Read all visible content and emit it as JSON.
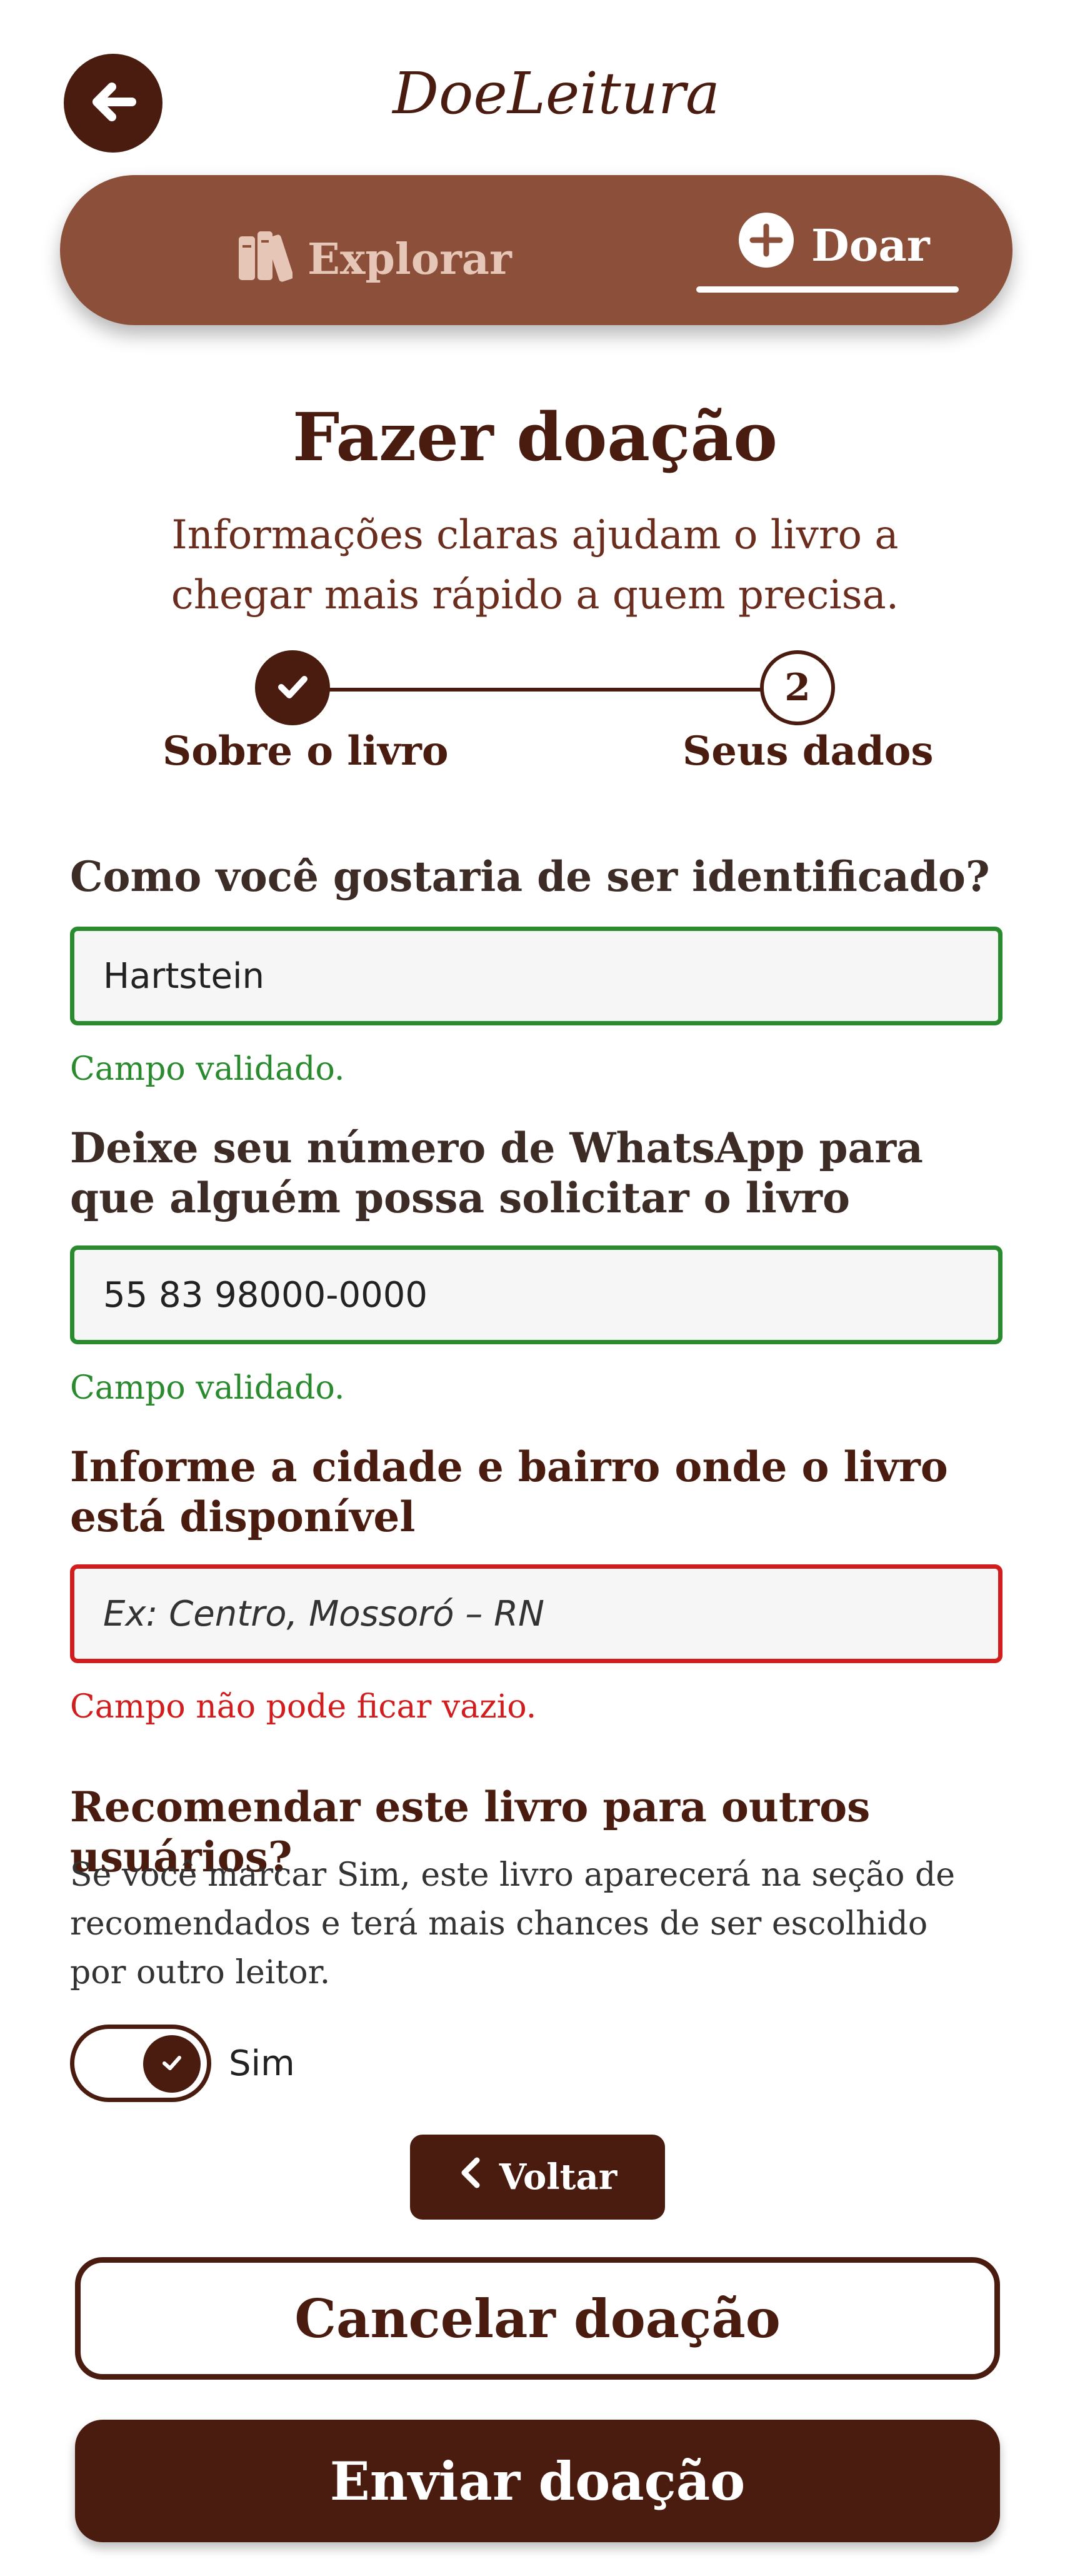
{
  "header": {
    "brand": "DoeLeitura"
  },
  "tabs": [
    {
      "label": "Explorar",
      "icon": "books-icon",
      "active": false
    },
    {
      "label": "Doar",
      "icon": "plus-circle-icon",
      "active": true
    }
  ],
  "page": {
    "title": "Fazer doação",
    "subtitle": "Informações claras ajudam o livro a chegar mais rápido a quem precisa."
  },
  "stepper": {
    "steps": [
      {
        "label": "Sobre o livro",
        "state": "done"
      },
      {
        "label": "Seus dados",
        "number": "2",
        "state": "current"
      }
    ]
  },
  "form": {
    "name": {
      "label": "Como você gostaria de ser identificado?",
      "value": "Hartstein",
      "message": "Campo validado."
    },
    "whatsapp": {
      "label": "Deixe seu número de WhatsApp para que alguém possa solicitar o livro",
      "value": "55 83 98000-0000",
      "message": "Campo validado."
    },
    "location": {
      "label": "Informe a cidade e bairro onde o livro está disponível",
      "placeholder": "Ex: Centro, Mossoró – RN",
      "message": "Campo não pode ficar vazio."
    },
    "recommend": {
      "label": "Recomendar este livro para outros usuários?",
      "description": "Se você marcar Sim, este livro aparecerá na seção de recomendados e terá mais chances de ser escolhido por outro leitor.",
      "toggle_label": "Sim",
      "checked": true
    }
  },
  "actions": {
    "back_label": "Voltar",
    "cancel_label": "Cancelar doação",
    "submit_label": "Enviar doação"
  },
  "colors": {
    "primary": "#4a1c10",
    "tabbar": "#8b4f3a",
    "success": "#2a8a2e",
    "error": "#d11d1d"
  }
}
